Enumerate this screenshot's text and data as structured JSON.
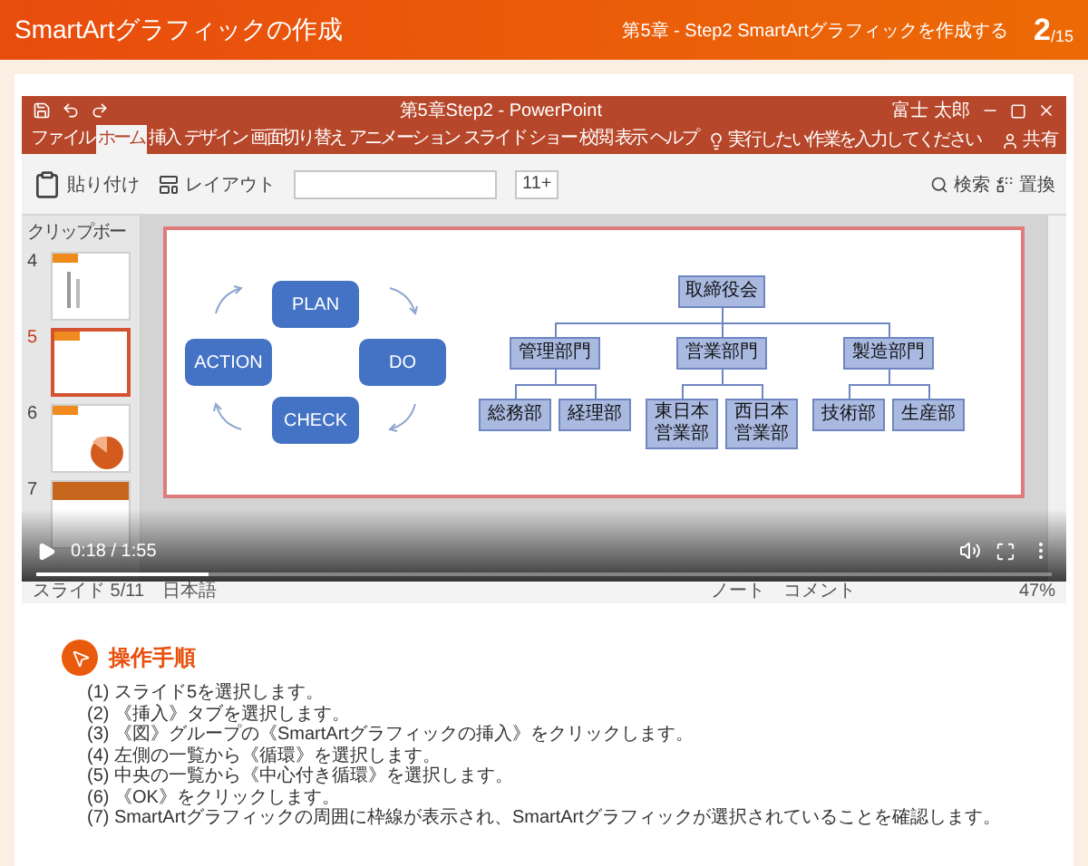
{
  "header": {
    "title": "SmartArtグラフィックの作成",
    "breadcrumb": "第5章 - Step2 SmartArtグラフィックを作成する",
    "page_current": "2",
    "page_total": "/15"
  },
  "video": {
    "title_bar": {
      "title": "第5章Step2 - PowerPoint",
      "user": "富士 太郎"
    },
    "ribbon_tabs": [
      {
        "label": "ファイル",
        "selected": false
      },
      {
        "label": "ホーム",
        "selected": true
      },
      {
        "label": "挿入",
        "selected": false
      },
      {
        "label": "デザイン",
        "selected": false
      },
      {
        "label": "画面切り替え",
        "selected": false
      },
      {
        "label": "アニメーション",
        "selected": false
      },
      {
        "label": "スライド ショー",
        "selected": false
      },
      {
        "label": "校閲",
        "selected": false
      },
      {
        "label": "表示",
        "selected": false
      },
      {
        "label": "ヘルプ",
        "selected": false
      }
    ],
    "tell_me": "実行したい作業を入力してください",
    "share": "共有",
    "ribbon": {
      "paste": "貼り付け",
      "layout": "レイアウト",
      "font_size": "11+",
      "search": "検索",
      "replace": "置換"
    },
    "pane_label": "クリップボー",
    "thumbnails": [
      {
        "number": "4",
        "selected": false,
        "kind": "text"
      },
      {
        "number": "5",
        "selected": true,
        "kind": "blank"
      },
      {
        "number": "6",
        "selected": false,
        "kind": "chart"
      },
      {
        "number": "7",
        "selected": false,
        "kind": "title"
      }
    ],
    "cycle": [
      "PLAN",
      "DO",
      "CHECK",
      "ACTION"
    ],
    "org": {
      "label": "取締役会",
      "children": [
        {
          "label": "管理部門",
          "children": [
            {
              "label": "総務部"
            },
            {
              "label": "経理部"
            }
          ]
        },
        {
          "label": "営業部門",
          "children": [
            {
              "label": "東日本営業部"
            },
            {
              "label": "西日本営業部"
            }
          ]
        },
        {
          "label": "製造部門",
          "children": [
            {
              "label": "技術部"
            },
            {
              "label": "生産部"
            }
          ]
        }
      ]
    },
    "status_bar": {
      "slide": "スライド 5/11",
      "language": "日本語",
      "notes": "ノート",
      "comments": "コメント",
      "zoom": "47%"
    },
    "player": {
      "time": "0:18 / 1:55",
      "level": 0.17
    }
  },
  "steps": {
    "heading": "操作手順",
    "items": [
      "(1) スライド5を選択します。",
      "(2) 《挿入》タブを選択します。",
      "(3) 《図》グループの《SmartArtグラフィックの挿入》をクリックします。",
      "(4) 左側の一覧から《循環》を選択します。",
      "(5) 中央の一覧から《中心付き循環》を選択します。",
      "(6) 《OK》をクリックします。",
      "(7) SmartArtグラフィックの周囲に枠線が表示され、SmartArtグラフィックが選択されていることを確認します。"
    ]
  }
}
